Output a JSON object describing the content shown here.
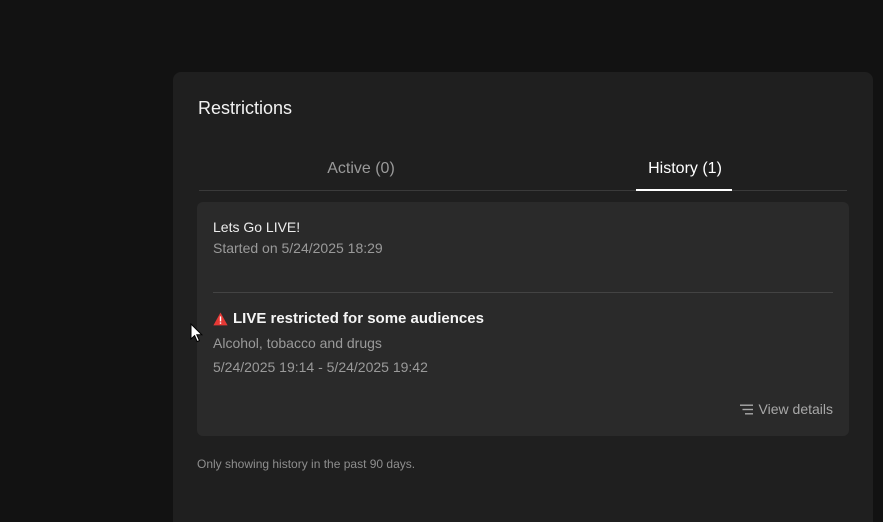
{
  "panel": {
    "title": "Restrictions"
  },
  "tabs": [
    {
      "label": "Active (0)",
      "active": false
    },
    {
      "label": "History (1)",
      "active": true
    }
  ],
  "history": {
    "live_title": "Lets Go LIVE!",
    "started": "Started on 5/24/2025 18:29",
    "restriction": {
      "icon": "warning-triangle-icon",
      "title": "LIVE restricted for some audiences",
      "category": "Alcohol, tobacco and drugs",
      "range": "5/24/2025 19:14 - 5/24/2025 19:42"
    },
    "view_details_label": "View details"
  },
  "footnote": "Only showing history in the past 90 days.",
  "colors": {
    "background": "#121212",
    "panel": "#1f1f1f",
    "card": "#2a2a2a",
    "warning": "#e53935"
  }
}
